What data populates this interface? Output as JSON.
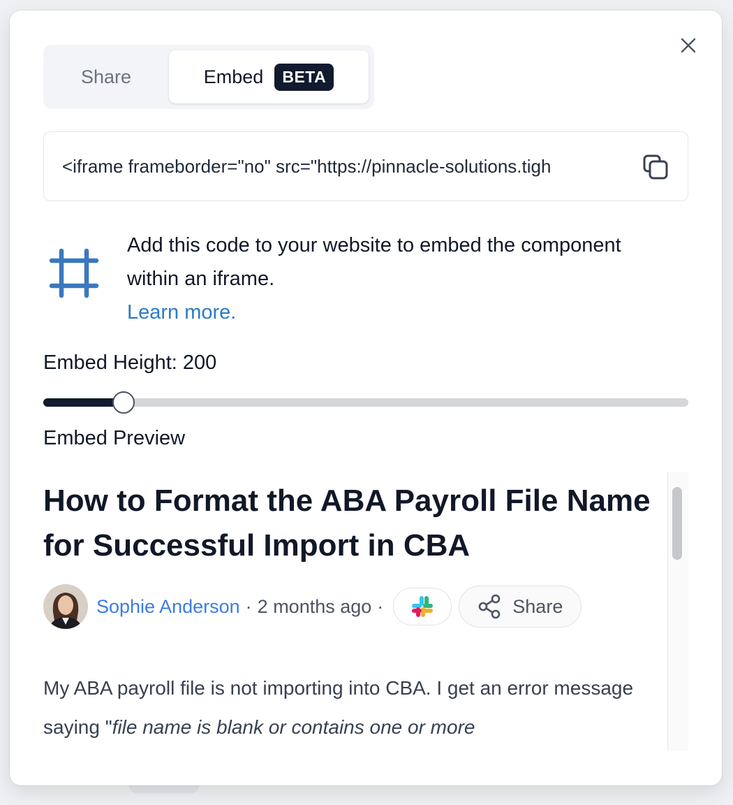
{
  "tabs": {
    "share_label": "Share",
    "embed_label": "Embed",
    "beta_badge": "BETA",
    "active": "embed"
  },
  "embed_code": {
    "value": "<iframe frameborder=\"no\" src=\"https://pinnacle-solutions.tigh"
  },
  "info": {
    "text": "Add this code to your website to embed the component within an iframe.",
    "link_label": "Learn more."
  },
  "height": {
    "label": "Embed Height: 200",
    "value": 200,
    "fill_fraction": 0.124
  },
  "preview": {
    "label": "Embed Preview",
    "title": "How to Format the ABA Payroll File Name for Successful Import in CBA",
    "author": "Sophie Anderson",
    "separator": "·",
    "time": "2 months ago",
    "share_label": "Share",
    "body_plain": "My ABA payroll file is not importing into CBA. I get an error message saying \"",
    "body_italic": "file name is blank or contains one or more"
  },
  "icons": {
    "close": "close-icon",
    "copy": "copy-icon",
    "frame": "hash-frame-icon",
    "slack": "slack-icon",
    "share": "share-nodes-icon"
  },
  "colors": {
    "accent_link": "#2b7cc4",
    "author_link": "#3b7de0",
    "badge_bg": "#111a2e",
    "frame_icon": "#3a78bf"
  }
}
